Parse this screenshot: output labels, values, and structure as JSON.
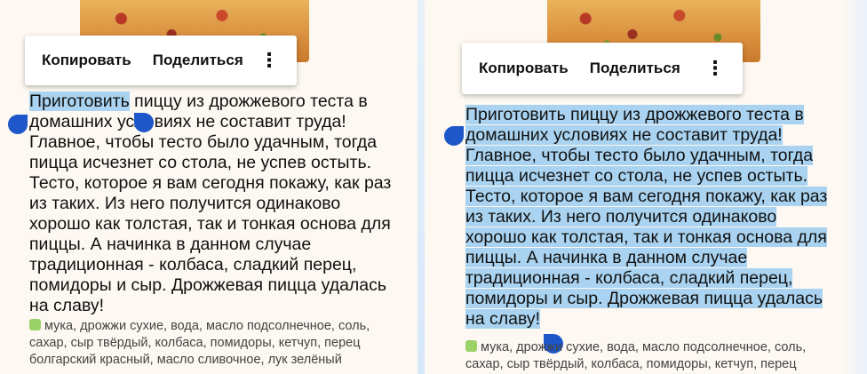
{
  "action_bar": {
    "copy": "Копировать",
    "share": "Поделиться",
    "more": "⋮"
  },
  "left": {
    "lines": [
      [
        "Приготовить",
        " пиццу из дрожжевого теста в"
      ],
      [
        "домашних условиях не составит труда!"
      ],
      [
        "Главное, чтобы тесто было удачным, тогда"
      ],
      [
        "пицца исчезнет со стола, не успев остыть."
      ],
      [
        "Тесто, которое я вам сегодня покажу, как раз"
      ],
      [
        "из таких. Из него получится одинаково"
      ],
      [
        "хорошо как толстая, так и тонкая основа для"
      ],
      [
        "пиццы. А начинка в данном случае"
      ],
      [
        "традиционная - колбаса, сладкий перец,"
      ],
      [
        "помидоры и сыр. Дрожжевая пицца удалась"
      ],
      [
        "на славу!"
      ]
    ],
    "ingredients": [
      "мука, дрожжи сухие, вода, масло подсолнечное, соль,",
      "сахар, сыр твёрдый, колбаса, помидоры, кетчуп, перец",
      "болгарский красный, масло сливочное, лук зелёный"
    ]
  },
  "right": {
    "lines": [
      "Приготовить пиццу из дрожжевого теста в",
      "домашних условиях не составит труда!",
      "Главное, чтобы тесто было удачным, тогда",
      "пицца исчезнет со стола, не успев остыть.",
      "Тесто, которое я вам сегодня покажу, как раз",
      "из таких. Из него получится одинаково",
      "хорошо как толстая, так и тонкая основа для",
      "пиццы. А начинка в данном случае",
      "традиционная - колбаса, сладкий перец,",
      "помидоры и сыр. Дрожжевая пицца удалась",
      "на славу!"
    ],
    "ingredients": [
      "мука, дрожжи сухие, вода, масло подсолнечное, соль,",
      "сахар, сыр твёрдый, колбаса, помидоры, кетчуп, перец"
    ]
  },
  "colors": {
    "selection": "#a9d3f0",
    "handle": "#1d57c9",
    "leaf": "#9bd268"
  }
}
